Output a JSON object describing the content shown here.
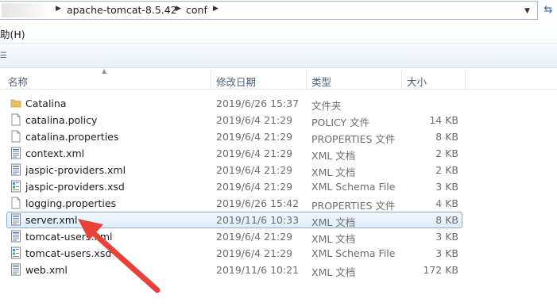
{
  "address_bar": {
    "crumbs": [
      "apache-tomcat-8.5.42",
      "conf"
    ]
  },
  "menu": {
    "help_label": "助(H)"
  },
  "columns": {
    "name": "名称",
    "date": "修改日期",
    "type": "类型",
    "size": "大小"
  },
  "files": [
    {
      "name": "Catalina",
      "date": "2019/6/26 15:37",
      "type": "文件夹",
      "size": "",
      "icon": "folder-icon"
    },
    {
      "name": "catalina.policy",
      "date": "2019/6/4 21:29",
      "type": "POLICY 文件",
      "size": "14 KB",
      "icon": "document-icon"
    },
    {
      "name": "catalina.properties",
      "date": "2019/6/4 21:29",
      "type": "PROPERTIES 文件",
      "size": "8 KB",
      "icon": "document-icon"
    },
    {
      "name": "context.xml",
      "date": "2019/6/4 21:29",
      "type": "XML 文档",
      "size": "2 KB",
      "icon": "xml-file-icon"
    },
    {
      "name": "jaspic-providers.xml",
      "date": "2019/6/4 21:29",
      "type": "XML 文档",
      "size": "2 KB",
      "icon": "xml-file-icon"
    },
    {
      "name": "jaspic-providers.xsd",
      "date": "2019/6/4 21:29",
      "type": "XML Schema File",
      "size": "3 KB",
      "icon": "xsd-file-icon"
    },
    {
      "name": "logging.properties",
      "date": "2019/6/26 15:42",
      "type": "PROPERTIES 文件",
      "size": "4 KB",
      "icon": "document-icon"
    },
    {
      "name": "server.xml",
      "date": "2019/11/6 10:33",
      "type": "XML 文档",
      "size": "8 KB",
      "icon": "xml-file-icon",
      "selected": true
    },
    {
      "name": "tomcat-users.xml",
      "date": "2019/6/4 21:29",
      "type": "XML 文档",
      "size": "3 KB",
      "icon": "xml-file-icon"
    },
    {
      "name": "tomcat-users.xsd",
      "date": "2019/6/4 21:29",
      "type": "XML Schema File",
      "size": "3 KB",
      "icon": "xsd-file-icon"
    },
    {
      "name": "web.xml",
      "date": "2019/11/6 10:21",
      "type": "XML 文档",
      "size": "172 KB",
      "icon": "xml-file-icon"
    }
  ],
  "colors": {
    "selection_border": "#84acdd",
    "annotation_arrow": "#e8413a",
    "folder": "#e8c15a"
  }
}
